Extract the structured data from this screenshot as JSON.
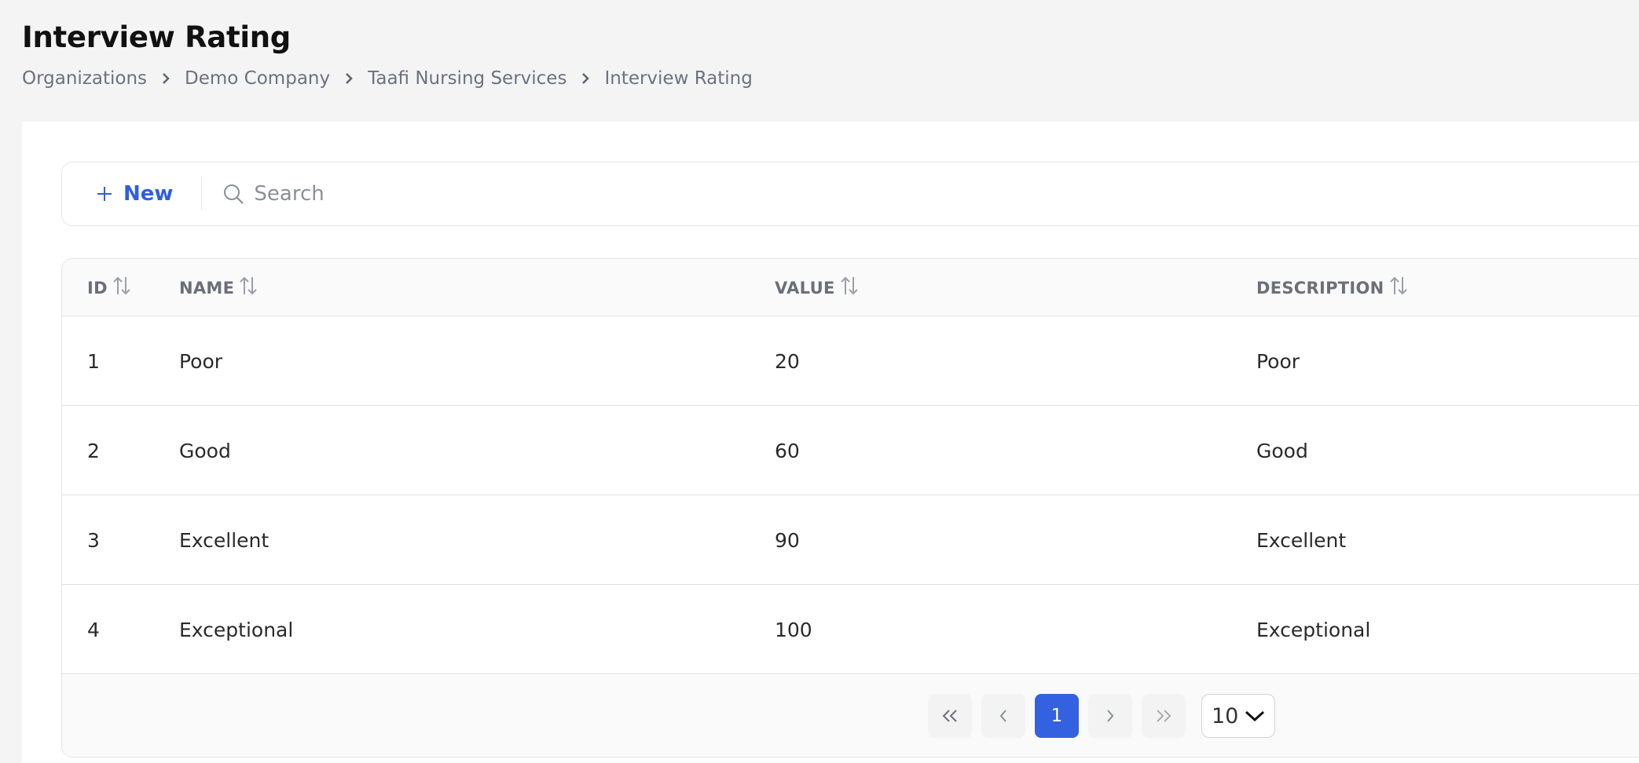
{
  "page": {
    "title": "Interview Rating",
    "breadcrumb": [
      "Organizations",
      "Demo Company",
      "Taafi Nursing Services",
      "Interview Rating"
    ]
  },
  "toolbar": {
    "new_label": "New",
    "search_placeholder": "Search"
  },
  "table": {
    "columns": [
      "ID",
      "NAME",
      "VALUE",
      "DESCRIPTION"
    ],
    "rows": [
      {
        "id": "1",
        "name": "Poor",
        "value": "20",
        "description": "Poor"
      },
      {
        "id": "2",
        "name": "Good",
        "value": "60",
        "description": "Good"
      },
      {
        "id": "3",
        "name": "Excellent",
        "value": "90",
        "description": "Excellent"
      },
      {
        "id": "4",
        "name": "Exceptional",
        "value": "100",
        "description": "Exceptional"
      }
    ]
  },
  "pagination": {
    "current_page": "1",
    "page_size": "10"
  },
  "colors": {
    "accent": "#3461e0",
    "background": "#f4f4f4"
  }
}
